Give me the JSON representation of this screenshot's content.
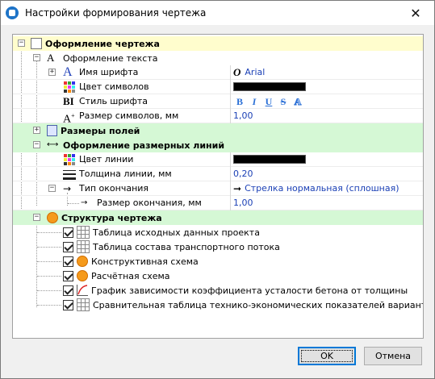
{
  "window": {
    "title": "Настройки формирования чертежа"
  },
  "tree": {
    "drawing_design": "Оформление чертежа",
    "text_design": "Оформление текста",
    "font_name": {
      "label": "Имя шрифта",
      "value": "Arial"
    },
    "font_color": {
      "label": "Цвет символов",
      "value": "#000000"
    },
    "font_style": {
      "label": "Стиль шрифта",
      "buttons": [
        "B",
        "I",
        "U",
        "S",
        "A"
      ]
    },
    "font_size": {
      "label": "Размер символов, мм",
      "value": "1,00"
    },
    "margins": "Размеры полей",
    "dim_lines": "Оформление размерных линий",
    "line_color": {
      "label": "Цвет линии",
      "value": "#000000"
    },
    "line_thickness": {
      "label": "Толщина линии, мм",
      "value": "0,20"
    },
    "end_type": {
      "label": "Тип окончания",
      "value": "Стрелка нормальная (сплошная)"
    },
    "end_size": {
      "label": "Размер окончания, мм",
      "value": "1,00"
    },
    "structure": "Структура чертежа",
    "items": [
      {
        "label": "Таблица исходных данных проекта",
        "icon": "table-icon",
        "checked": true
      },
      {
        "label": "Таблица состава транспортного потока",
        "icon": "table-icon",
        "checked": true
      },
      {
        "label": "Конструктивная схема",
        "icon": "scheme-icon",
        "checked": true
      },
      {
        "label": "Расчётная схема",
        "icon": "scheme-icon",
        "checked": true
      },
      {
        "label": "График зависимости коэффициента усталости бетона от толщины",
        "icon": "graph-icon",
        "checked": true
      },
      {
        "label": "Сравнительная таблица технико-экономических показателей вариантов",
        "icon": "table-icon",
        "checked": true
      }
    ]
  },
  "buttons": {
    "ok": "OK",
    "cancel": "Отмена"
  }
}
